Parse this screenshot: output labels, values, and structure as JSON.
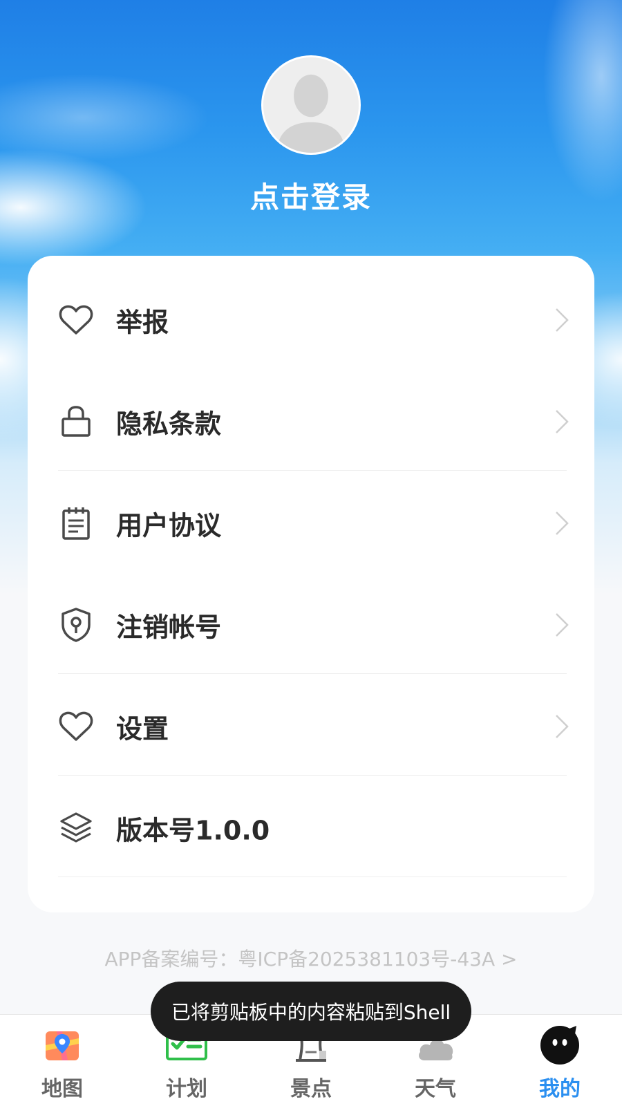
{
  "colors": {
    "sky_top": "#1f7fe6",
    "accent": "#2b8ff0",
    "label": "#2a2a2a",
    "icp_text": "#c4c4c4",
    "tab_inactive": "#666666"
  },
  "profile": {
    "login_label": "点击登录",
    "avatar_icon": "default-user-silhouette"
  },
  "menu": {
    "items": [
      {
        "label": "举报",
        "icon": "heart-icon"
      },
      {
        "label": "隐私条款",
        "icon": "lock-icon"
      },
      {
        "label": "用户协议",
        "icon": "notepad-icon"
      },
      {
        "label": "注销帐号",
        "icon": "shield-keyhole-icon"
      },
      {
        "label": "设置",
        "icon": "heart-icon"
      },
      {
        "label": "版本号1.0.0",
        "icon": "layers-icon"
      }
    ]
  },
  "footer": {
    "icp": "APP备案编号：粤ICP备2025381103号-43A >"
  },
  "toast": {
    "message": "已将剪贴板中的内容粘贴到Shell"
  },
  "tabbar": {
    "tabs": [
      {
        "label": "地图",
        "icon": "map-icon",
        "active": false
      },
      {
        "label": "计划",
        "icon": "checklist-icon",
        "active": false
      },
      {
        "label": "景点",
        "icon": "landmark-icon",
        "active": false
      },
      {
        "label": "天气",
        "icon": "cloud-icon",
        "active": false
      },
      {
        "label": "我的",
        "icon": "mascot-icon",
        "active": true
      }
    ]
  }
}
